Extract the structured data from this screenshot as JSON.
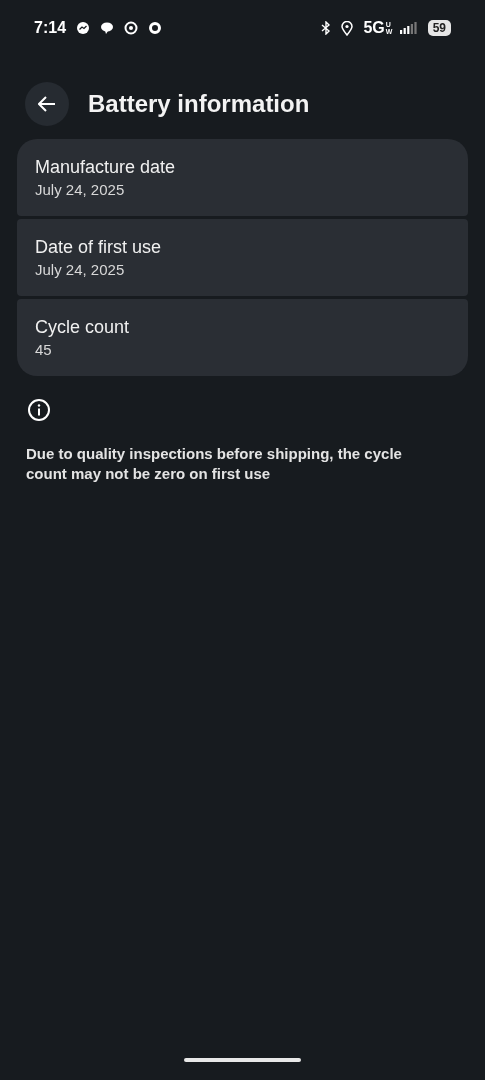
{
  "status_bar": {
    "time": "7:14",
    "network": "5G",
    "network_badge": "UW",
    "battery": "59"
  },
  "header": {
    "title": "Battery information"
  },
  "items": [
    {
      "title": "Manufacture date",
      "value": "July 24, 2025"
    },
    {
      "title": "Date of first use",
      "value": "July 24, 2025"
    },
    {
      "title": "Cycle count",
      "value": "45"
    }
  ],
  "note": "Due to quality inspections before shipping, the cycle count may not be zero on first use"
}
